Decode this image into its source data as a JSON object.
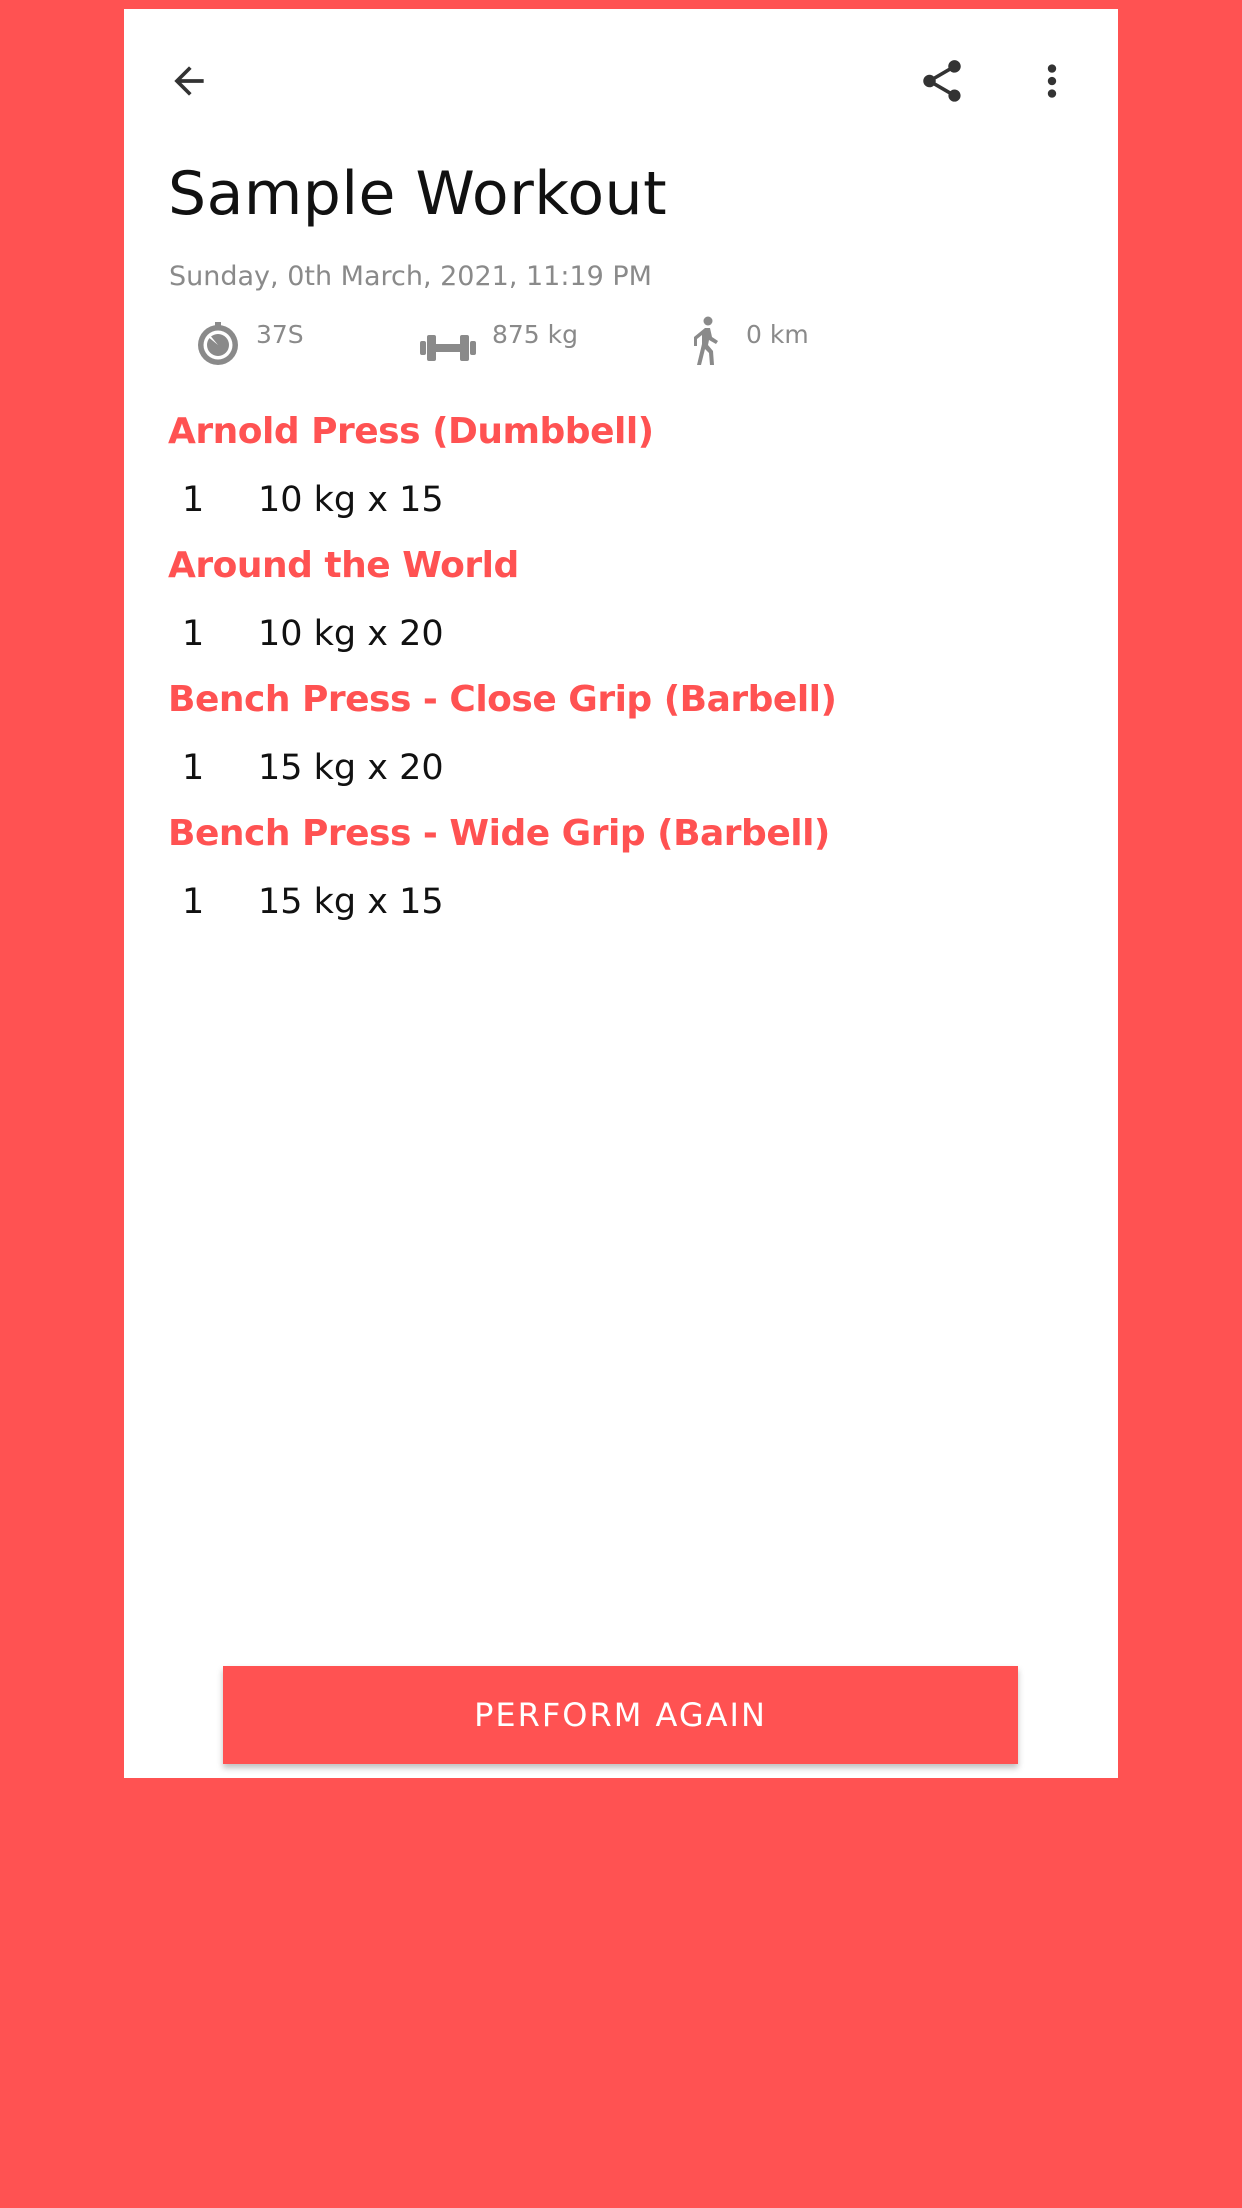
{
  "workout": {
    "title": "Sample Workout",
    "date": "Sunday, 0th March, 2021, 11:19 PM"
  },
  "stats": {
    "duration": "37S",
    "weight": "875 kg",
    "distance": "0 km"
  },
  "exercises": [
    {
      "name": "Arnold Press (Dumbbell)",
      "sets": [
        {
          "num": "1",
          "detail": "10 kg x 15"
        }
      ]
    },
    {
      "name": "Around the World",
      "sets": [
        {
          "num": "1",
          "detail": "10 kg x 20"
        }
      ]
    },
    {
      "name": "Bench Press - Close Grip (Barbell)",
      "sets": [
        {
          "num": "1",
          "detail": "15 kg x 20"
        }
      ]
    },
    {
      "name": "Bench Press - Wide Grip (Barbell)",
      "sets": [
        {
          "num": "1",
          "detail": "15 kg x 15"
        }
      ]
    }
  ],
  "actions": {
    "perform_again": "PERFORM AGAIN"
  },
  "icons": {
    "back": "arrow-back-icon",
    "share": "share-icon",
    "more": "more-vert-icon",
    "duration": "timer-icon",
    "weight": "dumbbell-icon",
    "distance": "walk-icon"
  },
  "colors": {
    "accent": "#FF5252",
    "background": "#FF5252",
    "card": "#FFFFFF",
    "text_primary": "#111111",
    "text_secondary": "#8A8A8A"
  }
}
